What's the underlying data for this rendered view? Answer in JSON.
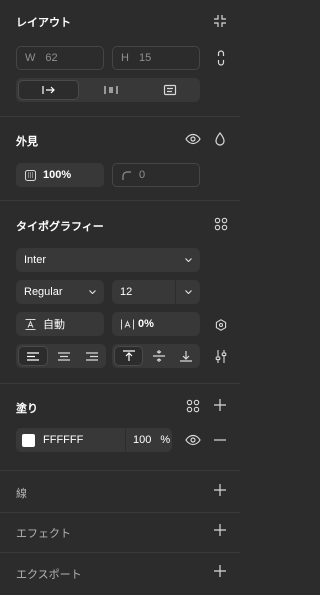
{
  "layout": {
    "title": "レイアウト",
    "width_label": "W",
    "width_value": "62",
    "height_label": "H",
    "height_value": "15"
  },
  "appearance": {
    "title": "外見",
    "opacity": "100%",
    "corner_radius": "0"
  },
  "typography": {
    "title": "タイポグラフィー",
    "font_family": "Inter",
    "font_weight": "Regular",
    "font_size": "12",
    "line_height": "自動",
    "letter_spacing": "0%"
  },
  "fill": {
    "title": "塗り",
    "hex": "FFFFFF",
    "opacity": "100",
    "percent_sign": "%",
    "swatch_color": "#FFFFFF"
  },
  "sections": {
    "stroke": "線",
    "effects": "エフェクト",
    "export": "エクスポート"
  }
}
